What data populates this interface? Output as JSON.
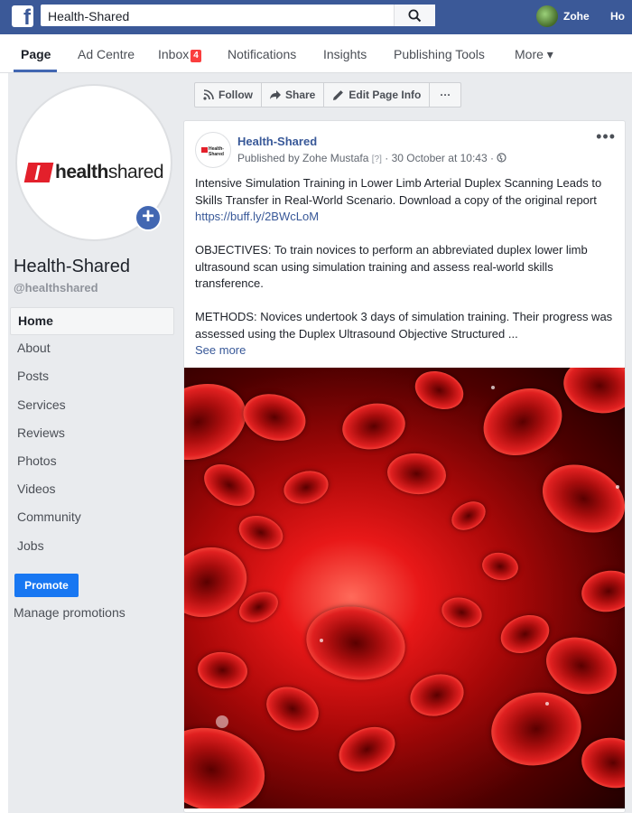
{
  "topbar": {
    "search_value": "Health-Shared",
    "user_name": "Zohe",
    "home_label": "Ho"
  },
  "tabs": [
    {
      "label": "Page"
    },
    {
      "label": "Ad Centre"
    },
    {
      "label": "Inbox",
      "badge": "4"
    },
    {
      "label": "Notifications"
    },
    {
      "label": "Insights"
    },
    {
      "label": "Publishing Tools"
    },
    {
      "label": "More ▾"
    }
  ],
  "sidebar": {
    "logo_brand": "health",
    "logo_brand_light": "shared",
    "page_name": "Health-Shared",
    "page_handle": "@healthshared",
    "nav": [
      "Home",
      "About",
      "Posts",
      "Services",
      "Reviews",
      "Photos",
      "Videos",
      "Community",
      "Jobs"
    ],
    "promote_label": "Promote",
    "manage_label": "Manage promotions"
  },
  "actions": {
    "follow": "Follow",
    "share": "Share",
    "edit": "Edit Page Info",
    "more": "···"
  },
  "post": {
    "author": "Health-Shared",
    "published_by": "Published by Zohe Mustafa",
    "help_mark": "[?]",
    "timestamp": "· 30 October at 10:43 ·",
    "more": "•••",
    "para1": "Intensive Simulation Training in Lower Limb Arterial Duplex Scanning Leads to Skills Transfer in Real-World Scenario. Download a copy of the original report ",
    "link": "https://buff.ly/2BWcLoM",
    "para2": "OBJECTIVES: To train novices to perform an abbreviated duplex lower limb ultrasound scan using simulation training and assess real-world skills transference.",
    "para3": "METHODS: Novices undertook 3 days of simulation training. Their progress was assessed using the Duplex Ultrasound Objective Structured ...",
    "see_more": "See more"
  },
  "colors": {
    "brand_blue": "#3b5998",
    "link_blue": "#385898",
    "logo_red": "#e3202b",
    "promote_blue": "#1877f2"
  }
}
